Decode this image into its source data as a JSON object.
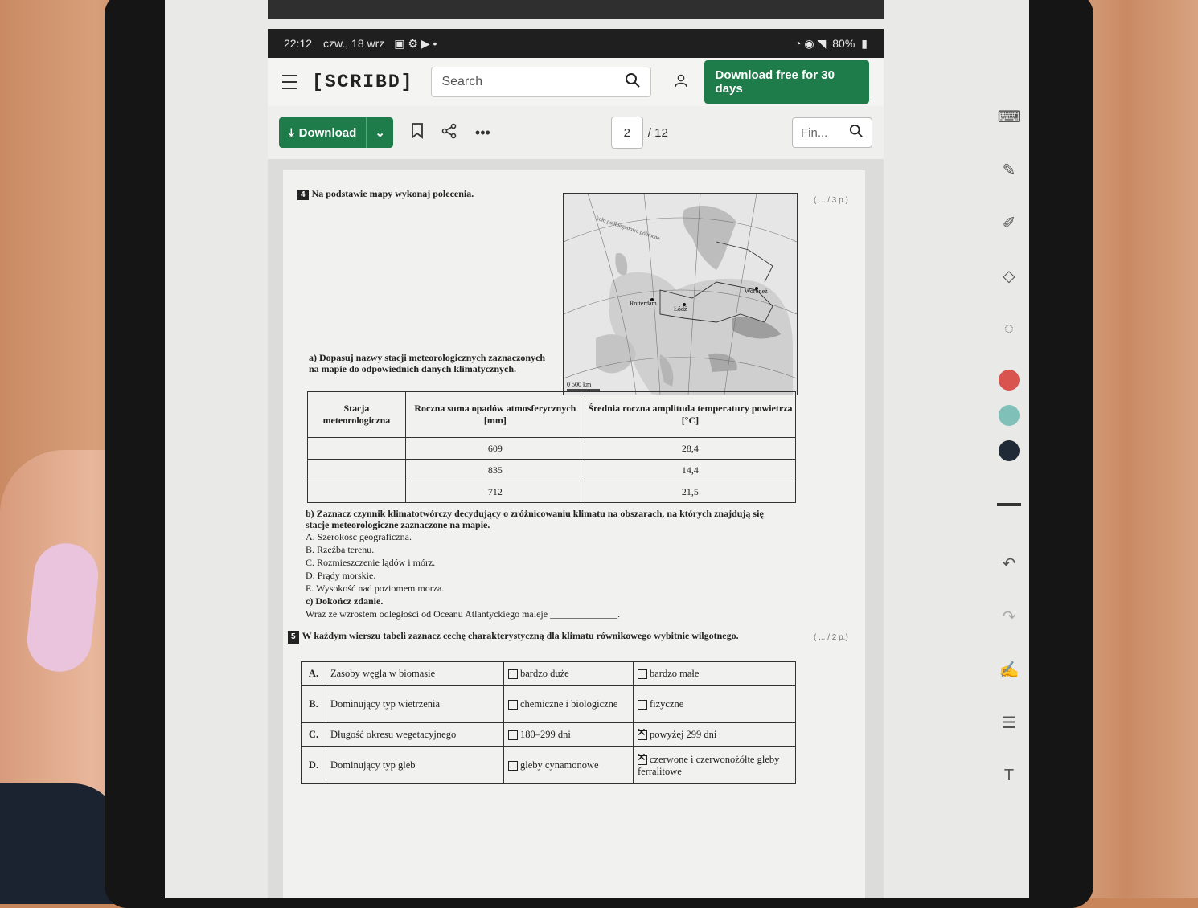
{
  "status_bar": {
    "time": "22:12",
    "date": "czw., 18 wrz",
    "battery": "80%"
  },
  "app_bar": {
    "logo": "[SCRIBD]",
    "search_placeholder": "Search",
    "cta_label": "Download free for 30 days"
  },
  "toolbar": {
    "download_label": "Download",
    "current_page": "2",
    "total_pages": "/ 12",
    "find_placeholder": "Fin..."
  },
  "document": {
    "q4": {
      "number": "4",
      "title": "Na podstawie mapy wykonaj polecenia.",
      "points": "( ... / 3 p.)",
      "map_labels": {
        "scale": "0     500 km",
        "city1": "Rotterdam",
        "city2": "Łódź",
        "city3": "Woroneż",
        "line": "koło podbiegunowe północne"
      },
      "a_text": "a) Dopasuj nazwy stacji meteorologicznych zaznaczonych na mapie do odpowiednich danych klimatycznych.",
      "table_headers": [
        "Stacja meteorologiczna",
        "Roczna suma opadów atmosferycznych [mm]",
        "Średnia roczna amplituda temperatury powietrza [°C]"
      ],
      "table_rows": [
        [
          "",
          "609",
          "28,4"
        ],
        [
          "",
          "835",
          "14,4"
        ],
        [
          "",
          "712",
          "21,5"
        ]
      ],
      "b_text": "b) Zaznacz czynnik klimatotwórczy decydujący o zróżnicowaniu klimatu na obszarach, na których znajdują się stacje meteorologiczne zaznaczone na mapie.",
      "b_options": [
        "A. Szerokość geograficzna.",
        "B. Rzeźba terenu.",
        "C. Rozmieszczenie lądów i mórz.",
        "D. Prądy morskie.",
        "E. Wysokość nad poziomem morza."
      ],
      "c_title": "c) Dokończ zdanie.",
      "c_text": "Wraz ze wzrostem odległości od Oceanu Atlantyckiego maleje ______________."
    },
    "q5": {
      "number": "5",
      "title": "W każdym wierszu tabeli zaznacz cechę charakterystyczną dla klimatu równikowego wybitnie wilgotnego.",
      "points": "( ... / 2 p.)",
      "rows": [
        {
          "letter": "A.",
          "feature": "Zasoby węgla w biomasie",
          "opt1": "bardzo duże",
          "opt2": "bardzo małe"
        },
        {
          "letter": "B.",
          "feature": "Dominujący typ wietrzenia",
          "opt1": "chemiczne i biologiczne",
          "opt2": "fizyczne"
        },
        {
          "letter": "C.",
          "feature": "Długość okresu wegetacyjnego",
          "opt1": "180–299 dni",
          "opt2": "powyżej 299 dni"
        },
        {
          "letter": "D.",
          "feature": "Dominujący typ gleb",
          "opt1": "gleby cynamonowe",
          "opt2": "czerwone i czerwonożółte gleby ferralitowe"
        }
      ]
    }
  },
  "colors": {
    "brand_green": "#1e7b4a",
    "pen_red": "#d9534f",
    "pen_teal": "#7fc1b8",
    "pen_dark": "#1f2a36"
  }
}
